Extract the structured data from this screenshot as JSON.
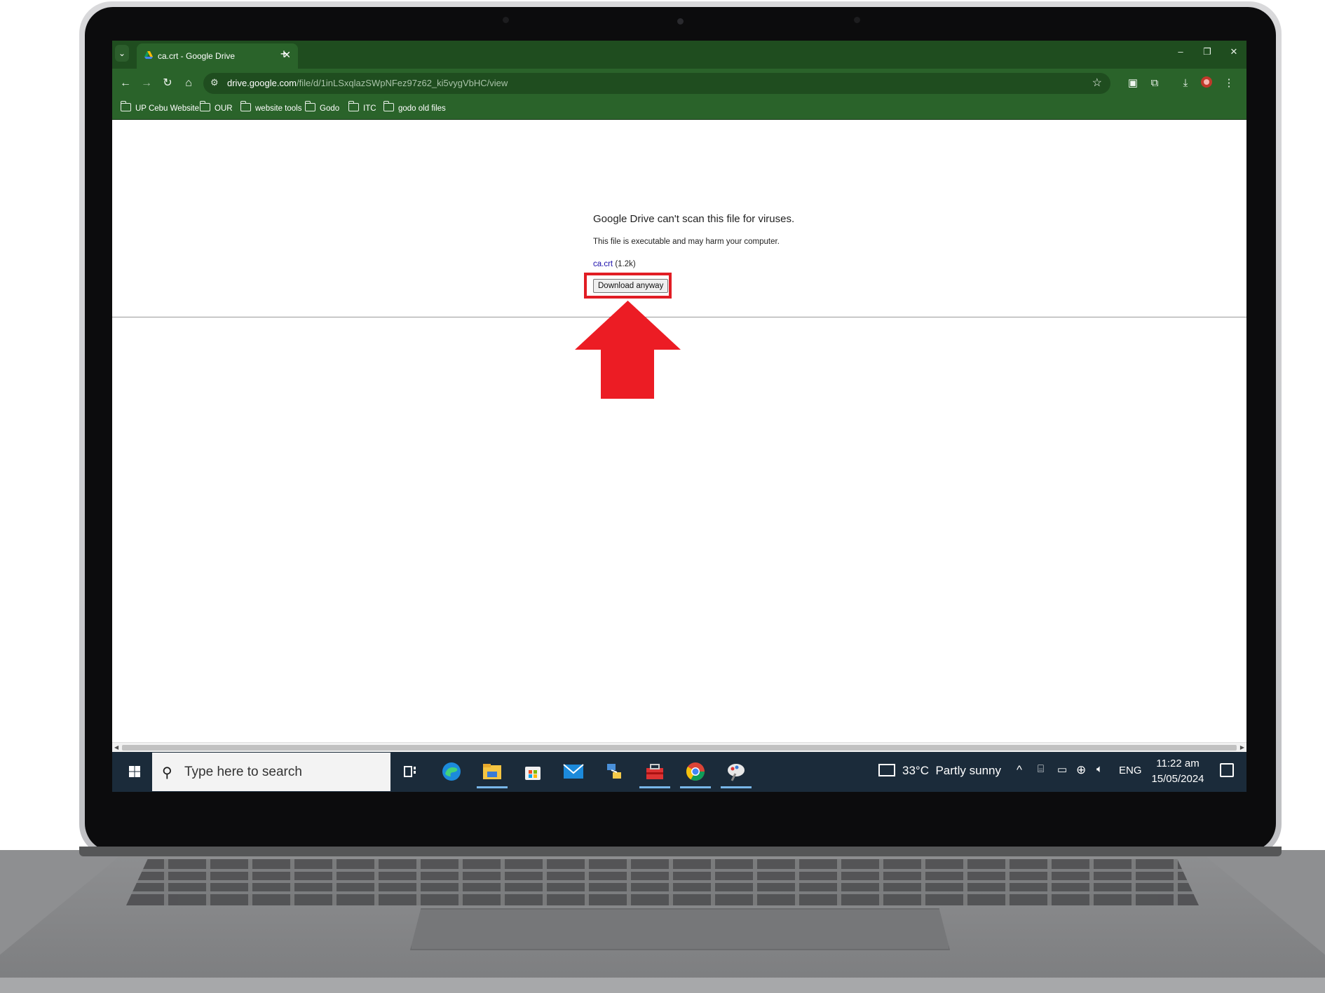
{
  "browser": {
    "tab_title": "ca.crt - Google Drive",
    "new_tab_label": "+",
    "url_host": "drive.google.com",
    "url_path": "/file/d/1inLSxqlazSWpNFez97z62_ki5vygVbHC/view",
    "theme_color": "#2a632a",
    "bookmarks": [
      "UP Cebu Website",
      "OUR",
      "website tools",
      "Godo",
      "ITC",
      "godo old files"
    ]
  },
  "page": {
    "heading": "Google Drive can't scan this file for viruses.",
    "warning": "This file is executable and may harm your computer.",
    "file_name": "ca.crt",
    "file_size": "(1.2k)",
    "download_button": "Download anyway"
  },
  "annotation": {
    "highlight_color": "#e11d24"
  },
  "taskbar": {
    "search_placeholder": "Type here to search",
    "weather_temp": "33°C",
    "weather_desc": "Partly sunny",
    "language": "ENG",
    "time": "11:22 am",
    "date": "15/05/2024",
    "apps": [
      "task-view-icon",
      "edge-icon",
      "file-explorer-icon",
      "store-icon",
      "mail-icon",
      "network-app-icon",
      "toolbox-app-icon",
      "chrome-icon",
      "paint-app-icon"
    ]
  }
}
